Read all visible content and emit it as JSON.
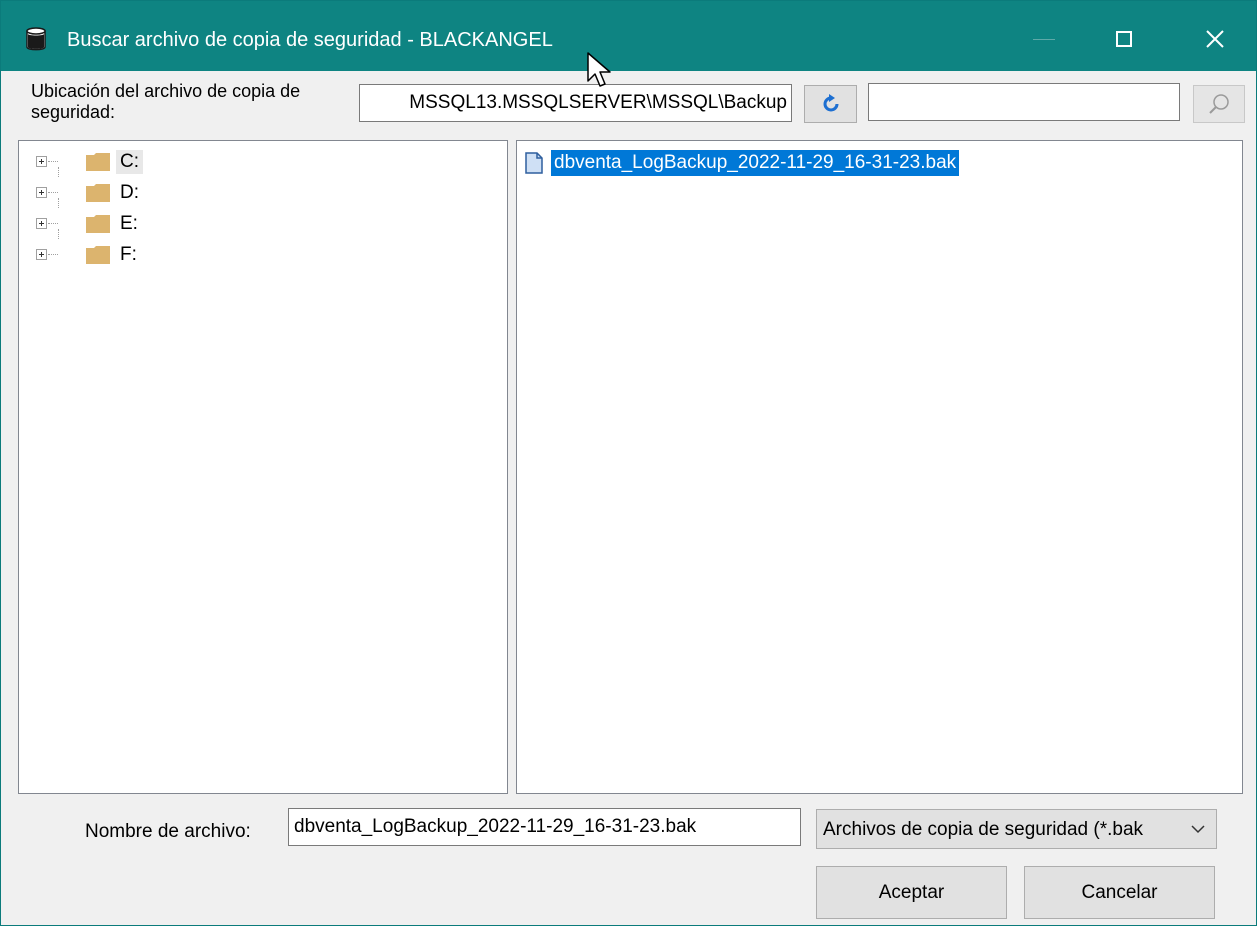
{
  "window": {
    "title": "Buscar archivo de copia de seguridad - BLACKANGEL"
  },
  "location": {
    "label": "Ubicación del archivo de copia de seguridad:",
    "path": "MSSQL13.MSSQLSERVER\\MSSQL\\Backup",
    "search_value": ""
  },
  "tree": {
    "drives": [
      {
        "label": "C:",
        "selected": true
      },
      {
        "label": "D:",
        "selected": false
      },
      {
        "label": "E:",
        "selected": false
      },
      {
        "label": "F:",
        "selected": false
      }
    ]
  },
  "files": {
    "items": [
      {
        "name": "dbventa_LogBackup_2022-11-29_16-31-23.bak",
        "selected": true
      }
    ]
  },
  "bottom": {
    "filename_label": "Nombre de archivo:",
    "filename_value": "dbventa_LogBackup_2022-11-29_16-31-23.bak",
    "filetype_value": "Archivos de copia de seguridad (*.bak",
    "ok_label": "Aceptar",
    "cancel_label": "Cancelar"
  },
  "colors": {
    "titlebar": "#0e8482",
    "selection": "#0078d7",
    "folder": "#dcb46e"
  }
}
